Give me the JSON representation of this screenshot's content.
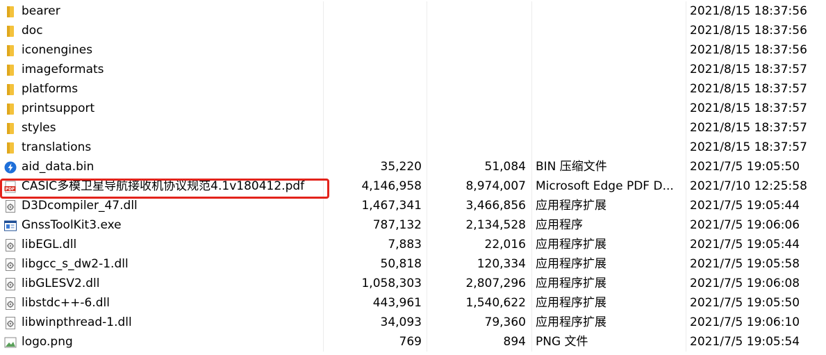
{
  "files": [
    {
      "name": "bearer",
      "size": "",
      "compressed": "",
      "type": "",
      "date": "2021/8/15 18:37:56",
      "icon": "folder-icon"
    },
    {
      "name": "doc",
      "size": "",
      "compressed": "",
      "type": "",
      "date": "2021/8/15 18:37:56",
      "icon": "folder-icon"
    },
    {
      "name": "iconengines",
      "size": "",
      "compressed": "",
      "type": "",
      "date": "2021/8/15 18:37:56",
      "icon": "folder-icon"
    },
    {
      "name": "imageformats",
      "size": "",
      "compressed": "",
      "type": "",
      "date": "2021/8/15 18:37:57",
      "icon": "folder-icon"
    },
    {
      "name": "platforms",
      "size": "",
      "compressed": "",
      "type": "",
      "date": "2021/8/15 18:37:57",
      "icon": "folder-icon"
    },
    {
      "name": "printsupport",
      "size": "",
      "compressed": "",
      "type": "",
      "date": "2021/8/15 18:37:57",
      "icon": "folder-icon"
    },
    {
      "name": "styles",
      "size": "",
      "compressed": "",
      "type": "",
      "date": "2021/8/15 18:37:57",
      "icon": "folder-icon"
    },
    {
      "name": "translations",
      "size": "",
      "compressed": "",
      "type": "",
      "date": "2021/8/15 18:37:57",
      "icon": "folder-icon"
    },
    {
      "name": "aid_data.bin",
      "size": "35,220",
      "compressed": "51,084",
      "type": "BIN 压缩文件",
      "date": "2021/7/5 19:05:50",
      "icon": "archive-icon"
    },
    {
      "name": "CASIC多模卫星导航接收机协议规范4.1v180412.pdf",
      "size": "4,146,958",
      "compressed": "8,974,007",
      "type": "Microsoft Edge PDF D...",
      "date": "2021/7/10 12:25:58",
      "icon": "pdf-icon"
    },
    {
      "name": "D3Dcompiler_47.dll",
      "size": "1,467,341",
      "compressed": "3,466,856",
      "type": "应用程序扩展",
      "date": "2021/7/5 19:05:44",
      "icon": "dll-icon"
    },
    {
      "name": "GnssToolKit3.exe",
      "size": "787,132",
      "compressed": "2,134,528",
      "type": "应用程序",
      "date": "2021/7/5 19:06:06",
      "icon": "exe-icon"
    },
    {
      "name": "libEGL.dll",
      "size": "7,883",
      "compressed": "22,016",
      "type": "应用程序扩展",
      "date": "2021/7/5 19:05:44",
      "icon": "dll-icon"
    },
    {
      "name": "libgcc_s_dw2-1.dll",
      "size": "50,818",
      "compressed": "120,334",
      "type": "应用程序扩展",
      "date": "2021/7/5 19:05:58",
      "icon": "dll-icon"
    },
    {
      "name": "libGLESV2.dll",
      "size": "1,058,303",
      "compressed": "2,807,296",
      "type": "应用程序扩展",
      "date": "2021/7/5 19:06:08",
      "icon": "dll-icon"
    },
    {
      "name": "libstdc++-6.dll",
      "size": "443,961",
      "compressed": "1,540,622",
      "type": "应用程序扩展",
      "date": "2021/7/5 19:05:50",
      "icon": "dll-icon"
    },
    {
      "name": "libwinpthread-1.dll",
      "size": "34,093",
      "compressed": "79,360",
      "type": "应用程序扩展",
      "date": "2021/7/5 19:06:10",
      "icon": "dll-icon"
    },
    {
      "name": "logo.png",
      "size": "769",
      "compressed": "894",
      "type": "PNG 文件",
      "date": "2021/7/5 19:05:54",
      "icon": "image-icon"
    }
  ],
  "highlight_color": "#e3231b",
  "folder_color": "#f4c23c",
  "highlighted_row_index": 9
}
